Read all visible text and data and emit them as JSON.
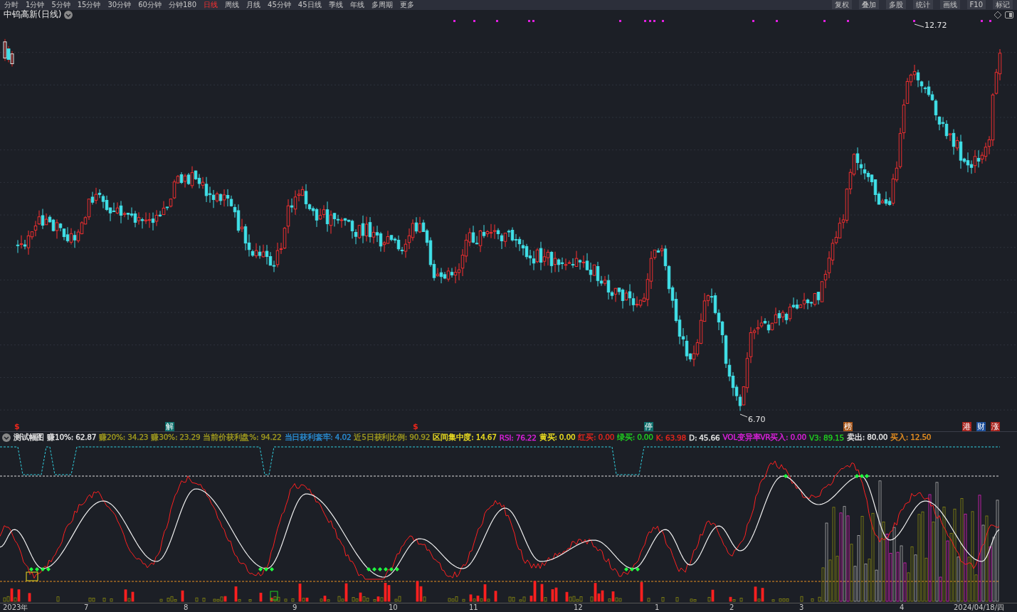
{
  "toolbar": {
    "periods": [
      {
        "label": "分时",
        "selected": false
      },
      {
        "label": "1分钟",
        "selected": false
      },
      {
        "label": "5分钟",
        "selected": false
      },
      {
        "label": "15分钟",
        "selected": false
      },
      {
        "label": "30分钟",
        "selected": false
      },
      {
        "label": "60分钟",
        "selected": false
      },
      {
        "label": "分钟180",
        "selected": false
      },
      {
        "label": "日线",
        "selected": true
      },
      {
        "label": "周线",
        "selected": false
      },
      {
        "label": "月线",
        "selected": false
      },
      {
        "label": "45分钟",
        "selected": false
      },
      {
        "label": "45日线",
        "selected": false
      },
      {
        "label": "季线",
        "selected": false
      },
      {
        "label": "年线",
        "selected": false
      },
      {
        "label": "多周期",
        "selected": false
      },
      {
        "label": "更多",
        "selected": false
      }
    ],
    "tools": [
      "复权",
      "叠加",
      "多股",
      "统计",
      "画线",
      "F10",
      "标记"
    ]
  },
  "stock_title": "中钨高新(日线)",
  "price_labels": {
    "high": "12.72",
    "low": "6.70"
  },
  "event_markers": [
    {
      "label": "$",
      "color": "#e8261c"
    },
    {
      "label": "解",
      "color": "#0e6f6c"
    },
    {
      "label": "$",
      "color": "#e8261c"
    },
    {
      "label": "停",
      "color": "#0e6f6c"
    },
    {
      "label": "榜",
      "color": "#a8561a"
    },
    {
      "label": "港",
      "color": "#a8221c"
    },
    {
      "label": "财",
      "color": "#1d4f9a"
    },
    {
      "label": "涨",
      "color": "#a8221c"
    }
  ],
  "indicator": {
    "name": "测试幅图",
    "values": [
      {
        "text": "赚10%: 62.87",
        "color": "#e8e8e8"
      },
      {
        "text": "赚20%: 34.23",
        "color": "#a09a1e"
      },
      {
        "text": "赚30%: 23.29",
        "color": "#a09a1e"
      },
      {
        "text": "当前价获利盘%: 94.22",
        "color": "#a09a1e"
      },
      {
        "text": "当日获利套牢: 4.02",
        "color": "#2a8fd6"
      },
      {
        "text": "近5日获利比例: 90.92",
        "color": "#a09a1e"
      },
      {
        "text": "区间集中度: 14.67",
        "color": "#f0e020"
      },
      {
        "text": "RSI: 76.22",
        "color": "#e020e0"
      },
      {
        "text": "黄买: 0.00",
        "color": "#f0e020"
      },
      {
        "text": "红买: 0.00",
        "color": "#e8261c"
      },
      {
        "text": "绿买: 0.00",
        "color": "#20d020"
      },
      {
        "text": "K: 63.98",
        "color": "#e8261c"
      },
      {
        "text": "D: 45.66",
        "color": "#e8e8e8"
      },
      {
        "text": "VOL变异率VR买入: 0.00",
        "color": "#e020e0"
      },
      {
        "text": "V3: 89.15",
        "color": "#20d020"
      },
      {
        "text": "卖出: 80.00",
        "color": "#e8e8e8"
      },
      {
        "text": "买入: 12.50",
        "color": "#e89020"
      }
    ]
  },
  "time_axis": [
    "2023年",
    "7",
    "8",
    "9",
    "10",
    "11",
    "12",
    "1",
    "2",
    "3",
    "4",
    "2024/04/18/四"
  ]
}
